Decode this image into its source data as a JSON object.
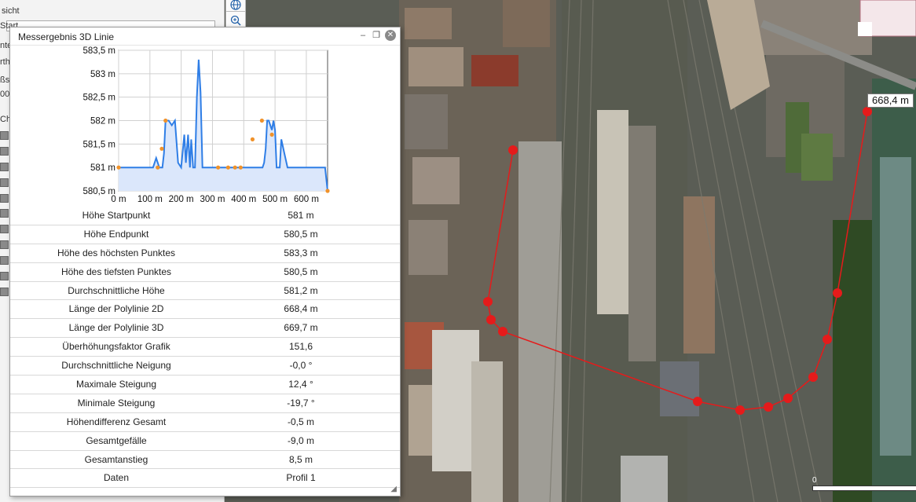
{
  "window": {
    "title": "Messergebnis 3D Linie",
    "min_label": "–",
    "restore_label": "❐",
    "close_label": "✕"
  },
  "left_panel": {
    "fragments": [
      "sicht",
      "Start",
      "nte",
      "rth",
      "ßs",
      "00",
      "Ch"
    ]
  },
  "map": {
    "distance_label": "668,4 m",
    "scale_zero": "0",
    "route_color": "#e51b1b"
  },
  "chart_data": {
    "type": "area",
    "title": "",
    "xlabel": "",
    "ylabel": "",
    "xlim": [
      0,
      668
    ],
    "ylim": [
      580.5,
      583.5
    ],
    "grid": true,
    "line_color": "#2f7ee6",
    "fill_color": "#dbe7fb",
    "marker_color": "#f0922a",
    "y_ticks": [
      "583,5 m",
      "583 m",
      "582,5 m",
      "582 m",
      "581,5 m",
      "581 m",
      "580,5 m"
    ],
    "y_tick_values": [
      583.5,
      583,
      582.5,
      582,
      581.5,
      581,
      580.5
    ],
    "x_ticks": [
      "0 m",
      "100 m",
      "200 m",
      "300 m",
      "400 m",
      "500 m",
      "600 m"
    ],
    "x_tick_values": [
      0,
      100,
      200,
      300,
      400,
      500,
      600
    ],
    "series": [
      {
        "x": [
          0,
          20,
          40,
          55,
          60,
          80,
          95,
          105,
          110,
          120,
          130,
          140,
          145,
          150,
          160,
          170,
          180,
          190,
          200,
          210,
          215,
          222,
          228,
          232,
          238,
          244,
          250,
          256,
          262,
          268,
          272,
          276,
          280,
          285,
          290,
          295,
          300,
          310,
          320,
          330,
          340,
          350,
          360,
          370,
          380,
          390,
          400,
          410,
          420,
          430,
          440,
          450,
          455,
          460,
          465,
          470,
          475,
          480,
          485,
          490,
          495,
          500,
          505,
          510,
          515,
          520,
          530,
          540,
          545,
          550,
          555,
          560,
          565,
          570,
          580,
          590,
          600,
          610,
          620,
          630,
          640,
          650,
          660,
          668
        ],
        "y": [
          581,
          581,
          581,
          581,
          581,
          581,
          581,
          581,
          581,
          581.2,
          581,
          581,
          581.3,
          582,
          582,
          581.9,
          582,
          581.1,
          581,
          581.7,
          581.1,
          581.7,
          581,
          581.6,
          581,
          581,
          582.5,
          583.3,
          582.6,
          581,
          581,
          581,
          581,
          581,
          581,
          581,
          581,
          581,
          581,
          581,
          581,
          581,
          581,
          581,
          581,
          581,
          581,
          581,
          581,
          581,
          581,
          581,
          581,
          581,
          581.1,
          581.4,
          582,
          582,
          581.9,
          581.8,
          582,
          581.8,
          581,
          581,
          581,
          581.6,
          581.3,
          581,
          581,
          581,
          581,
          581,
          581,
          581,
          581,
          581,
          581,
          581,
          581,
          581,
          581,
          581,
          581,
          580.5
        ]
      }
    ],
    "markers": [
      {
        "x": 0,
        "y": 581
      },
      {
        "x": 125,
        "y": 581
      },
      {
        "x": 138,
        "y": 581.4
      },
      {
        "x": 150,
        "y": 582
      },
      {
        "x": 318,
        "y": 581
      },
      {
        "x": 350,
        "y": 581
      },
      {
        "x": 372,
        "y": 581
      },
      {
        "x": 390,
        "y": 581
      },
      {
        "x": 428,
        "y": 581.6
      },
      {
        "x": 458,
        "y": 582
      },
      {
        "x": 490,
        "y": 581.7
      },
      {
        "x": 668,
        "y": 580.5
      }
    ]
  },
  "table": {
    "rows": [
      {
        "label": "Höhe Startpunkt",
        "value": "581 m"
      },
      {
        "label": "Höhe Endpunkt",
        "value": "580,5 m"
      },
      {
        "label": "Höhe des höchsten Punktes",
        "value": "583,3 m"
      },
      {
        "label": "Höhe des tiefsten Punktes",
        "value": "580,5 m"
      },
      {
        "label": "Durchschnittliche Höhe",
        "value": "581,2 m"
      },
      {
        "label": "Länge der Polylinie 2D",
        "value": "668,4 m"
      },
      {
        "label": "Länge der Polylinie 3D",
        "value": "669,7 m"
      },
      {
        "label": "Überhöhungsfaktor Grafik",
        "value": "151,6"
      },
      {
        "label": "Durchschnittliche Neigung",
        "value": "-0,0 °"
      },
      {
        "label": "Maximale Steigung",
        "value": "12,4 °"
      },
      {
        "label": "Minimale Steigung",
        "value": "-19,7 °"
      },
      {
        "label": "Höhendifferenz Gesamt",
        "value": "-0,5 m"
      },
      {
        "label": "Gesamtgefälle",
        "value": "-9,0 m"
      },
      {
        "label": "Gesamtanstieg",
        "value": "8,5 m"
      },
      {
        "label": "Daten",
        "value": "Profil 1"
      }
    ]
  }
}
